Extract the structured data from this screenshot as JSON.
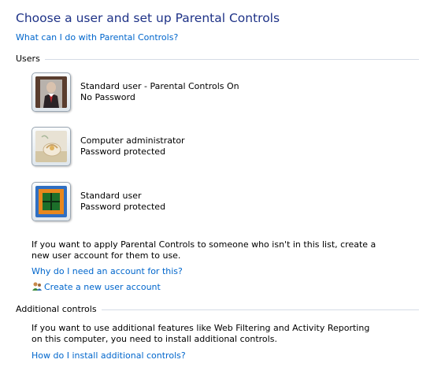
{
  "title": "Choose a user and set up Parental Controls",
  "help_link": "What can I do with Parental Controls?",
  "sections": {
    "users": "Users",
    "additional": "Additional controls"
  },
  "users": [
    {
      "role": "Standard user - Parental Controls On",
      "password": "No Password",
      "icon": "person-photo"
    },
    {
      "role": "Computer administrator",
      "password": "Password protected",
      "icon": "shell-photo"
    },
    {
      "role": "Standard user",
      "password": "Password protected",
      "icon": "window-tile"
    }
  ],
  "info_text": "If you want to apply Parental Controls to someone who isn't in this list, create a new user account for them to use.",
  "why_link": "Why do I need an account for this?",
  "create_link": "Create a new user account",
  "additional_text": "If you want to use additional features like Web Filtering and Activity Reporting on this computer, you need to install additional controls.",
  "install_link": "How do I install additional controls?",
  "colors": {
    "title": "#1e3287",
    "link": "#0066cc"
  }
}
